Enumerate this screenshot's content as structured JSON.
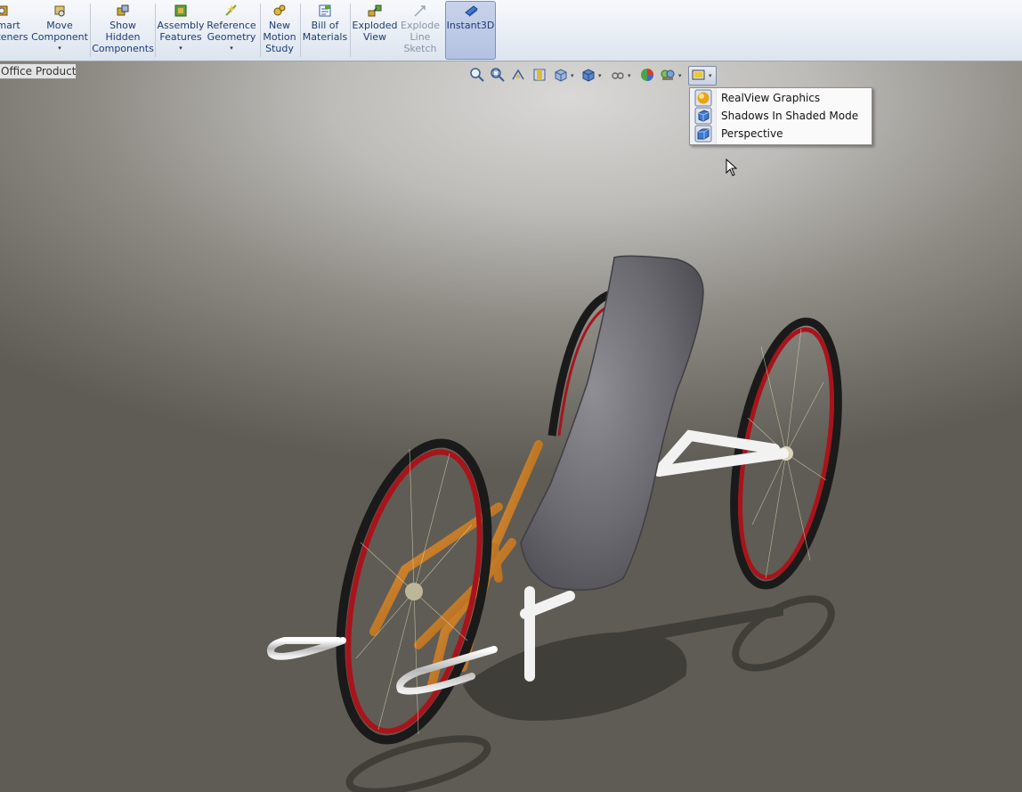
{
  "ribbon": {
    "smart_fasteners": "mart\nteners",
    "move_component": "Move\nComponent",
    "show_hidden": "Show\nHidden\nComponents",
    "assembly_features": "Assembly\nFeatures",
    "reference_geometry": "Reference\nGeometry",
    "new_motion_study": "New\nMotion\nStudy",
    "bill_of_materials": "Bill of\nMaterials",
    "exploded_view": "Exploded\nView",
    "explode_line_sketch": "Explode\nLine\nSketch",
    "instant3d": "Instant3D",
    "dropdown_arrow": "▾"
  },
  "tab": {
    "office_products": "Office Products"
  },
  "menu": {
    "items": [
      {
        "label": "RealView Graphics",
        "icon": "realview-sphere-icon"
      },
      {
        "label": "Shadows In Shaded Mode",
        "icon": "shadows-cube-icon"
      },
      {
        "label": "Perspective",
        "icon": "perspective-cube-icon"
      }
    ]
  },
  "hud_icons": [
    "zoom-to-fit-icon",
    "zoom-to-area-icon",
    "previous-view-icon",
    "section-view-icon",
    "view-orientation-icon",
    "display-style-icon",
    "hide-show-items-icon",
    "edit-appearance-icon",
    "apply-scene-icon",
    "view-settings-icon"
  ],
  "colors": {
    "ribbon_text": "#1e3b73",
    "frame_orange": "#c8781e",
    "rim_red": "#a8141a",
    "seat_gray": "#6b6b70"
  }
}
